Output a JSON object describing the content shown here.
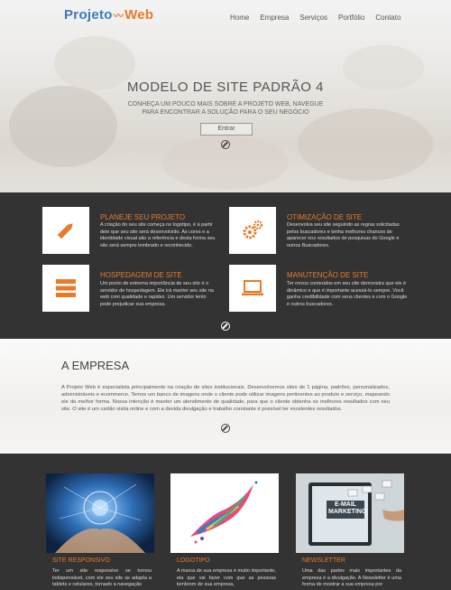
{
  "header": {
    "logo": {
      "part1": "Projeto",
      "part2": "Web"
    },
    "nav": [
      "Home",
      "Empresa",
      "Serviços",
      "Portfólio",
      "Contato"
    ]
  },
  "hero": {
    "title": "MODELO DE SITE PADRÃO 4",
    "subtitle": "CONHEÇA UM POUCO MAIS SOBRE A PROJETO WEB, NAVEGUE PARA ENCONTRAR A SOLUÇÃO PARA O SEU NEGÓCIO",
    "button": "Entrar"
  },
  "services": [
    {
      "title": "PLANEJE SEU PROJETO",
      "icon": "pencil-icon",
      "text": "A criação do seu site começa no logotipo, é à partir dele que seu site será desenvolvido. As cores e a identidade visual são a referência e desta forma seu site será sempre lembrado e reconhecido."
    },
    {
      "title": "OTIMIZAÇÃO DE SITE",
      "icon": "gears-icon",
      "text": "Desenvolva seu site seguindo as regras solicitadas pelos buscadores e tenha melhores chances de aparecer nos resultados de pesquisas do Google e outros Buscadores."
    },
    {
      "title": "HOSPEDAGEM DE SITE",
      "icon": "server-icon",
      "text": "Um ponto de extrema importância de seu site é o servidor de hospedagem. Ele irá manter seu site na web com qualidade e rapidez. Um servidor lento pode prejudicar sua empresa."
    },
    {
      "title": "MANUTENÇÃO DE SITE",
      "icon": "laptop-icon",
      "text": "Ter novos conteúdos em seu site demonstra que ele é dinâmico e que é importante acessá-lo sempre. Você ganha credibilidade com seus clientes e com o Google e outros buscadores."
    }
  ],
  "empresa": {
    "title": "A EMPRESA",
    "text": "A Projeto Web é especialista principalmente na criação de sites institucionais. Desenvolvemos sites de 1 página, padrões, personalizados, administráveis e ecommerce. Temos um banco de imagens onde o cliente pode utilizar imagens pertinentes ao produto e serviço, mapeando ele da melhor forma. Nossa intenção é manter um atendimento de qualidade, para que o cliente obtenha os melhores resultados com seu site. O site é um cartão visita online e com a devida divulgação e trabalho constante é possível ter excelentes resultados."
  },
  "features": [
    {
      "title": "SITE RESPONSIVO",
      "text": "Ter um site responsivo se tornou indispensável, com ele seu site se adapta a tablets e celulares, tornado a navegação"
    },
    {
      "title": "LOGOTIPO",
      "text": "A marca de sua empresa é muito importante, ela que vai fazer com que as pessoas lembrem de sua empresa,"
    },
    {
      "title": "NEWSLETTER",
      "text": "Uma das partes mais importantes da empresa é a divulgação. A Newsletter é uma forma de mostrar a sua empresa por"
    }
  ],
  "newsletter_image_text": {
    "line1": "E-MAIL",
    "line2": "MARKETING"
  },
  "colors": {
    "accent": "#e87b2a",
    "logo_blue": "#3f78c0",
    "dark_bg": "#333333"
  }
}
